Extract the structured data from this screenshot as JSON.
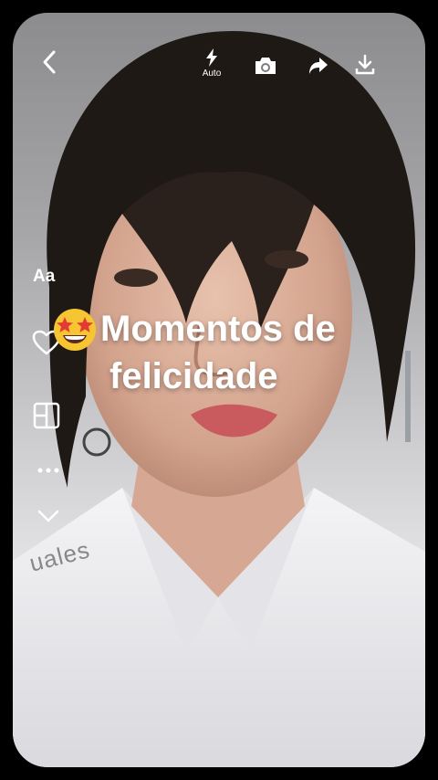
{
  "toolbar": {
    "back_icon": "chevron-left-icon",
    "flash_icon": "lightning-icon",
    "flash_label": "Auto",
    "camera_icon": "camera-icon",
    "share_icon": "share-arrow-icon",
    "download_icon": "download-icon"
  },
  "side_tools": {
    "text_label": "Aa",
    "like_icon": "heart-icon",
    "layout_icon": "layout-grid-icon",
    "more_icon": "more-dots-icon",
    "expand_icon": "chevron-down-icon"
  },
  "caption": {
    "emoji": "star-struck-emoji",
    "line1": "Momentos de",
    "line2": "felicidade"
  },
  "watermark": "uales",
  "colors": {
    "overlay_text": "#ffffff",
    "emoji_face": "#f7c531",
    "emoji_star": "#e53935"
  }
}
